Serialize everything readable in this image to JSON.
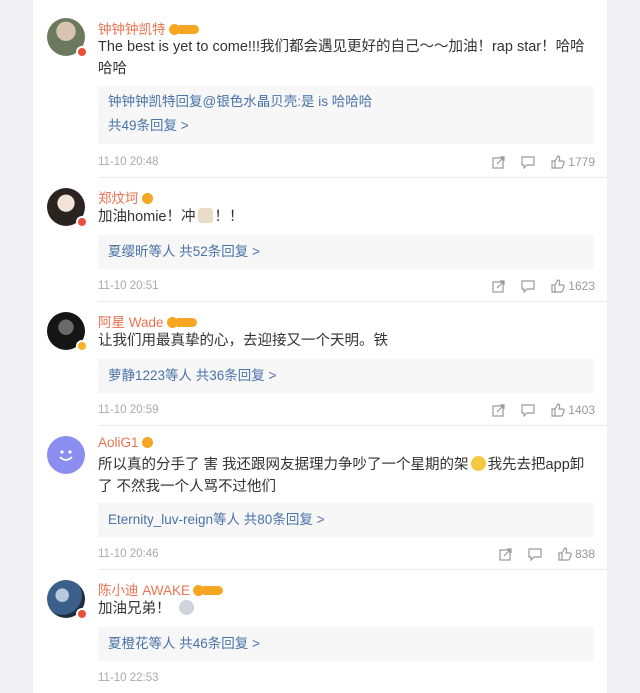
{
  "comments": [
    {
      "username": "钟钟钟凯特",
      "text": "The best is yet to come!!!我们都会遇见更好的自己～～加油！rap star！哈哈哈哈",
      "reply_line": "钟钟钟凯特回复@银色水晶贝壳:是 is 哈哈哈",
      "reply_more": "共49条回复 >",
      "time": "11-10 20:48",
      "likes": "1779"
    },
    {
      "username": "郑炆坷",
      "text_before": "加油homie！冲",
      "text_after": "！！",
      "reply_more": "夏缨昕等人 共52条回复 >",
      "time": "11-10 20:51",
      "likes": "1623"
    },
    {
      "username": "阿星 Wade",
      "text": "让我们用最真挚的心，去迎接又一个天明。铁",
      "reply_more": "萝静1223等人 共36条回复 >",
      "time": "11-10 20:59",
      "likes": "1403"
    },
    {
      "username": "AoliG1",
      "text_line1_before": "所以真的分手了 害 我还跟网友据理力争吵了一个星期的架",
      "text_line1_after": "我先去把app卸",
      "text_line2": "了 不然我一个人骂不过他们",
      "reply_more": "Eternity_luv-reign等人 共80条回复 >",
      "time": "11-10 20:46",
      "likes": "838"
    },
    {
      "username": "陈小迪 AWAKE",
      "text": "加油兄弟！",
      "reply_more": "夏橙花等人 共46条回复 >",
      "time": "11-10 22:53"
    }
  ],
  "colors": {
    "username": "#eb7350",
    "link": "#4a73a8",
    "meta": "#a9a9a9",
    "vip_badge": "#f6a623"
  }
}
